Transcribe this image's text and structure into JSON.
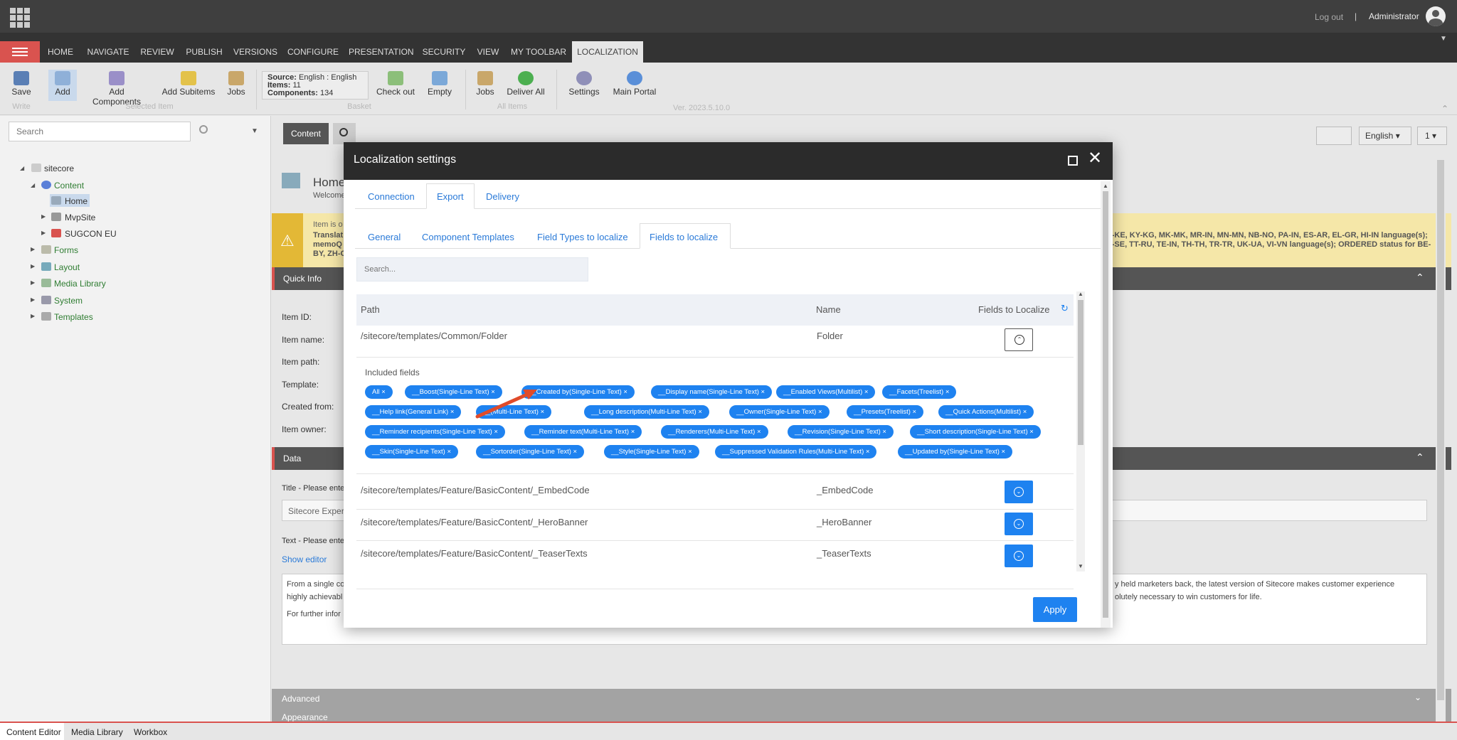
{
  "header": {
    "logout": "Log out",
    "divider": "|",
    "user": "Administrator"
  },
  "ribbon_tabs": [
    "HOME",
    "NAVIGATE",
    "REVIEW",
    "PUBLISH",
    "VERSIONS",
    "CONFIGURE",
    "PRESENTATION",
    "SECURITY",
    "VIEW",
    "MY TOOLBAR",
    "LOCALIZATION"
  ],
  "ribbon": {
    "save": "Save",
    "add": "Add",
    "add_components": "Add Components",
    "add_subitems": "Add Subitems",
    "jobs1": "Jobs",
    "source_label": "Source:",
    "source_value": "English : English",
    "items_label": "Items:",
    "items_value": "11",
    "components_label": "Components:",
    "components_value": "134",
    "checkout": "Check out",
    "empty": "Empty",
    "jobs2": "Jobs",
    "deliver_all": "Deliver All",
    "settings": "Settings",
    "main_portal": "Main Portal",
    "version": "Ver. 2023.5.10.0",
    "groups": {
      "write": "Write",
      "selected": "Selected Item",
      "basket": "Basket",
      "all": "All Items"
    }
  },
  "left": {
    "search_placeholder": "Search",
    "tree": {
      "sitecore": "sitecore",
      "content": "Content",
      "home": "Home",
      "mvpsite": "MvpSite",
      "sugcon": "SUGCON EU",
      "forms": "Forms",
      "layout": "Layout",
      "media": "Media Library",
      "system": "System",
      "templates": "Templates"
    }
  },
  "editor": {
    "tab_content": "Content",
    "lang": "English",
    "ver": "1",
    "home_title": "Home",
    "home_sub": "Welcome",
    "warn1": "Item is o",
    "warn2": "Translat",
    "warn3": "memoQ",
    "warn4": "BY, ZH-C",
    "warn_right1": "Y-KE, KY-KG, MK-MK, MR-IN, MN-MN, NB-NO, PA-IN, ES-AR, EL-GR, HI-IN language(s);",
    "warn_right2": "V-SE, TT-RU, TE-IN, TH-TH, TR-TR, UK-UA, VI-VN language(s); ORDERED status for BE-",
    "quick_info": "Quick Info",
    "data": "Data",
    "fields": [
      "Item ID:",
      "Item name:",
      "Item path:",
      "Template:",
      "Created from:",
      "Item owner:"
    ],
    "title_label": "Title - Please ente",
    "title_value": "Sitecore Experi",
    "text_label": "Text - Please ente",
    "show_editor": "Show editor",
    "text_l1": "From a single co",
    "text_l2": "highly achievabl",
    "text_l3": "For further infor",
    "text_r1": "y held marketers back, the latest version of Sitecore makes customer experience",
    "text_r2": "olutely necessary to win customers for life.",
    "advanced": "Advanced",
    "appearance": "Appearance"
  },
  "dialog": {
    "title": "Localization settings",
    "tabs": [
      "Connection",
      "Export",
      "Delivery"
    ],
    "subtabs": [
      "General",
      "Component Templates",
      "Field Types to localize",
      "Fields to localize"
    ],
    "search_placeholder": "Search...",
    "columns": {
      "path": "Path",
      "name": "Name",
      "fields": "Fields to Localize"
    },
    "row1": {
      "path": "/sitecore/templates/Common/Folder",
      "name": "Folder"
    },
    "included_label": "Included fields",
    "chips": [
      [
        "All",
        "__Boost(Single-Line Text)",
        "__Created by(Single-Line Text)",
        "__Display name(Single-Line Text)",
        "__Enabled Views(Multilist)",
        "__Facets(Treelist)"
      ],
      [
        "__Help link(General Link)",
        "__(Multi-Line Text)",
        "__Long description(Multi-Line Text)",
        "__Owner(Single-Line Text)",
        "__Presets(Treelist)",
        "__Quick Actions(Multilist)"
      ],
      [
        "__Reminder recipients(Single-Line Text)",
        "__Reminder text(Multi-Line Text)",
        "__Renderers(Multi-Line Text)",
        "__Revision(Single-Line Text)",
        "__Short description(Single-Line Text)"
      ],
      [
        "__Skin(Single-Line Text)",
        "__Sortorder(Single-Line Text)",
        "__Style(Single-Line Text)",
        "__Suppressed Validation Rules(Multi-Line Text)",
        "__Updated by(Single-Line Text)"
      ]
    ],
    "rows": [
      {
        "path": "/sitecore/templates/Feature/BasicContent/_EmbedCode",
        "name": "_EmbedCode"
      },
      {
        "path": "/sitecore/templates/Feature/BasicContent/_HeroBanner",
        "name": "_HeroBanner"
      },
      {
        "path": "/sitecore/templates/Feature/BasicContent/_TeaserTexts",
        "name": "_TeaserTexts"
      }
    ],
    "apply": "Apply"
  },
  "taskbar": [
    "Content Editor",
    "Media Library",
    "Workbox"
  ],
  "colors": {
    "accent": "#1e82f0",
    "brand_red": "#d9534f",
    "dark": "#2b2b2b"
  }
}
